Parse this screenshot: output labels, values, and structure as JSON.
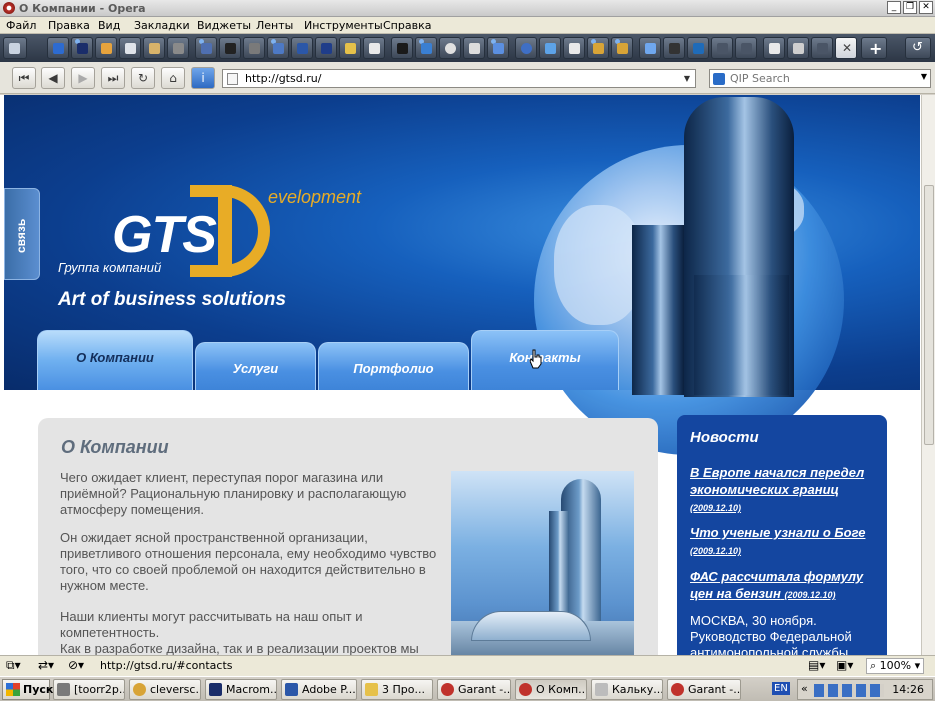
{
  "window": {
    "title": "О Компании - Opera"
  },
  "menu": [
    "Файл",
    "Правка",
    "Вид",
    "Закладки",
    "Виджеты",
    "Ленты",
    "Инструменты",
    "Справка"
  ],
  "nav": {
    "url": "http://gtsd.ru/",
    "search_placeholder": "QIP Search"
  },
  "site": {
    "logo_main": "GTS",
    "logo_dev": "evelopment",
    "logo_group": "Группа компаний",
    "slogan": "Art of business solutions",
    "side_tab": "связь",
    "tabs": [
      {
        "label": "О Компании",
        "active": true
      },
      {
        "label": "Услуги",
        "active": false
      },
      {
        "label": "Портфолио",
        "active": false
      },
      {
        "label": "Контакты",
        "active": false
      }
    ],
    "content": {
      "title": "О Компании",
      "paragraphs": [
        "Чего ожидает клиент, переступая порог магазина или приёмной? Рациональную планировку и располагающую атмосферу помещения.",
        "Он ожидает ясной пространственной организации, приветливого отношения персонала, ему необходимо чувство того, что со своей проблемой он находится действительно в нужном месте.",
        "Наши клиенты могут рассчитывать на наш опыт и компетентность.",
        "Как в разработке дизайна, так и в реализации проектов мы"
      ]
    },
    "news": {
      "title": "Новости",
      "items": [
        {
          "link": "В Европе начался передел экономических границ",
          "date": "(2009.12.10)"
        },
        {
          "link": "Что ученые узнали о Боге",
          "date": "(2009.12.10)"
        },
        {
          "link": "ФАС рассчитала формулу цен на бензин",
          "date": "(2009.12.10)"
        }
      ],
      "text": "МОСКВА, 30 ноября. Руководство Федеральной антимонопольной службы"
    }
  },
  "status": {
    "url": "http://gtsd.ru/#contacts",
    "zoom": "100%"
  },
  "taskbar": {
    "start": "Пуск",
    "items": [
      "[toorr2p...",
      "cleversc...",
      "Macrom...",
      "Adobe P...",
      "3 Про...",
      "Garant -...",
      "О Комп...",
      "Кальку...",
      "Garant -..."
    ],
    "lang": "EN",
    "clock": "14:26"
  },
  "colors": {
    "brand_gold": "#e8ac26",
    "brand_blue": "#1446a0"
  }
}
